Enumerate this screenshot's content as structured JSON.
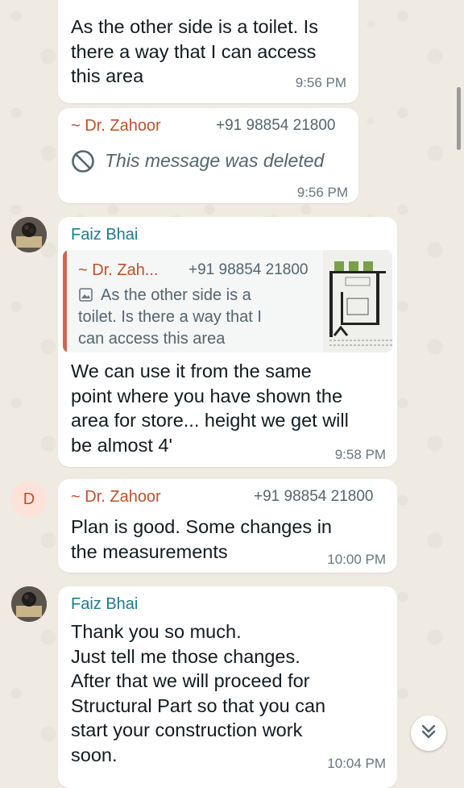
{
  "messages": [
    {
      "text": "As the other side is a toilet. Is\nthere a way that I can access\nthis area",
      "time": "9:56 PM"
    },
    {
      "sender_name": "~ Dr. Zahoor",
      "sender_phone": "+91 98854 21800",
      "deleted_text": "This message was deleted",
      "time": "9:56 PM"
    },
    {
      "sender_name": "Faiz Bhai",
      "quote": {
        "name": "~ Dr. Zah...",
        "phone": "+91 98854 21800",
        "text": "As the other side is a\ntoilet. Is there a way that I\ncan access this area"
      },
      "text": "We can use it from the same\npoint where you have shown the\narea for store... height we get will\nbe almost 4'",
      "time": "9:58 PM"
    },
    {
      "avatar_letter": "D",
      "sender_name": "~ Dr. Zahoor",
      "sender_phone": "+91 98854 21800",
      "text": "Plan is good. Some changes in\nthe measurements",
      "time": "10:00 PM"
    },
    {
      "sender_name": "Faiz Bhai",
      "text": "Thank you so much.\nJust tell me those changes.\nAfter that we will proceed for\nStructural Part so that you can\nstart your construction work\nsoon.",
      "time": "10:04 PM"
    }
  ],
  "colors": {
    "background": "#efeae2",
    "bubble": "#ffffff",
    "dr_zahoor_name": "#c0502a",
    "faiz_name": "#1f7a8c",
    "timestamp": "#667781"
  },
  "icons": {
    "deleted": "prohibited-icon",
    "quote_photo": "photo-icon",
    "scroll_down": "double-chevron-down-icon"
  }
}
